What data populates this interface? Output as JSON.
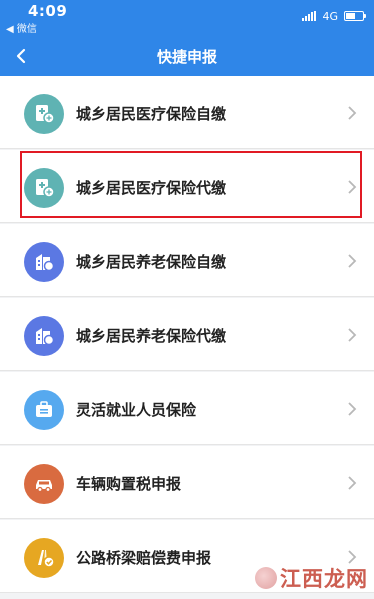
{
  "status": {
    "time": "4:09",
    "back_app": "◀ 微信",
    "network": "4G"
  },
  "nav": {
    "title": "快捷申报"
  },
  "items": [
    {
      "label": "城乡居民医疗保险自缴",
      "icon": "medical-insurance-icon",
      "color": "#5fb3b3"
    },
    {
      "label": "城乡居民医疗保险代缴",
      "icon": "medical-insurance-icon",
      "color": "#5fb3b3"
    },
    {
      "label": "城乡居民养老保险自缴",
      "icon": "pension-insurance-icon",
      "color": "#5b78e3"
    },
    {
      "label": "城乡居民养老保险代缴",
      "icon": "pension-insurance-icon",
      "color": "#5b78e3"
    },
    {
      "label": "灵活就业人员保险",
      "icon": "briefcase-icon",
      "color": "#56a9ef"
    },
    {
      "label": "车辆购置税申报",
      "icon": "car-icon",
      "color": "#d96b40"
    },
    {
      "label": "公路桥梁赔偿费申报",
      "icon": "bridge-compensation-icon",
      "color": "#e6a722"
    }
  ],
  "watermark": {
    "text": "江西龙网"
  },
  "colors": {
    "primary": "#2f86e8",
    "highlight": "#e11a24"
  }
}
